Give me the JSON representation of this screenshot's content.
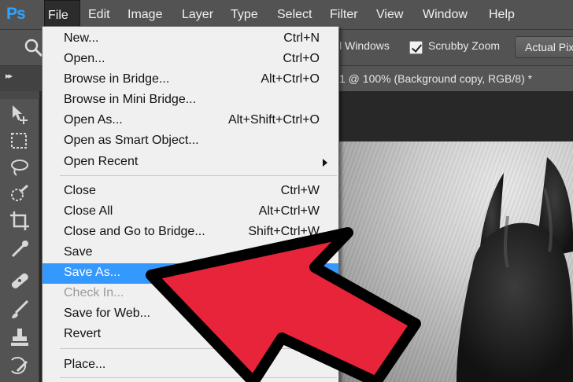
{
  "app": {
    "logo": "Ps"
  },
  "menubar": {
    "items": [
      {
        "label": "File"
      },
      {
        "label": "Edit"
      },
      {
        "label": "Image"
      },
      {
        "label": "Layer"
      },
      {
        "label": "Type"
      },
      {
        "label": "Select"
      },
      {
        "label": "Filter"
      },
      {
        "label": "View"
      },
      {
        "label": "Window"
      },
      {
        "label": "Help"
      }
    ]
  },
  "options": {
    "all_windows": "ll Windows",
    "scrubby_zoom": "Scrubby Zoom",
    "scrubby_checked": true,
    "actual_pixels": "Actual Pixels"
  },
  "document_tab": "1 @ 100% (Background copy, RGB/8) *",
  "file_menu": {
    "items": [
      {
        "label": "New...",
        "shortcut": "Ctrl+N"
      },
      {
        "label": "Open...",
        "shortcut": "Ctrl+O"
      },
      {
        "label": "Browse in Bridge...",
        "shortcut": "Alt+Ctrl+O"
      },
      {
        "label": "Browse in Mini Bridge...",
        "shortcut": ""
      },
      {
        "label": "Open As...",
        "shortcut": "Alt+Shift+Ctrl+O"
      },
      {
        "label": "Open as Smart Object...",
        "shortcut": ""
      },
      {
        "label": "Open Recent",
        "shortcut": ""
      },
      {
        "label": "Close",
        "shortcut": "Ctrl+W"
      },
      {
        "label": "Close All",
        "shortcut": "Alt+Ctrl+W"
      },
      {
        "label": "Close and Go to Bridge...",
        "shortcut": "Shift+Ctrl+W"
      },
      {
        "label": "Save",
        "shortcut": ""
      },
      {
        "label": "Save As...",
        "shortcut": ""
      },
      {
        "label": "Check In...",
        "shortcut": ""
      },
      {
        "label": "Save for Web...",
        "shortcut": ""
      },
      {
        "label": "Revert",
        "shortcut": ""
      },
      {
        "label": "Place...",
        "shortcut": ""
      }
    ],
    "selected": "Save As...",
    "disabled": [
      "Check In..."
    ]
  },
  "colors": {
    "menubar_bg": "#535353",
    "menu_bg": "#f0f0f0",
    "highlight": "#3399ff",
    "arrow_fill": "#e8243a",
    "logo": "#2fa3ff"
  },
  "icons": {
    "zoom": "zoom-icon",
    "move": "move-tool-icon",
    "marquee": "marquee-tool-icon",
    "lasso": "lasso-tool-icon",
    "quick_select": "quick-select-tool-icon",
    "crop": "crop-tool-icon",
    "eyedropper": "eyedropper-tool-icon",
    "healing": "healing-brush-tool-icon",
    "brush": "brush-tool-icon",
    "stamp": "clone-stamp-tool-icon",
    "history_brush": "history-brush-tool-icon",
    "submenu": "chevron-right-icon",
    "pointer_arrow": "annotation-arrow-icon"
  }
}
